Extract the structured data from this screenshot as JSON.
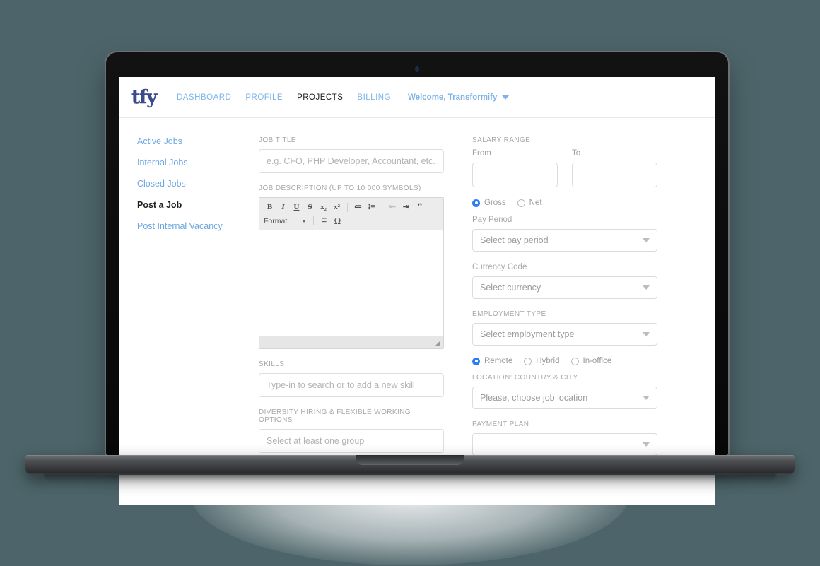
{
  "brand": {
    "logo_text": "tfy",
    "accent_blue": "#7fb4e8",
    "link_blue": "#6ba6e0",
    "radio_blue": "#2d7ff0",
    "page_background": "#4d656a"
  },
  "topnav": {
    "links": [
      {
        "label": "DASHBOARD",
        "active": false
      },
      {
        "label": "PROFILE",
        "active": false
      },
      {
        "label": "PROJECTS",
        "active": true
      },
      {
        "label": "BILLING",
        "active": false
      }
    ],
    "welcome": "Welcome, Transformify"
  },
  "sidebar": {
    "items": [
      {
        "label": "Active Jobs",
        "active": false
      },
      {
        "label": "Internal Jobs",
        "active": false
      },
      {
        "label": "Closed Jobs",
        "active": false
      },
      {
        "label": "Post a Job",
        "active": true
      },
      {
        "label": "Post Internal Vacancy",
        "active": false
      }
    ]
  },
  "form": {
    "job_title": {
      "label": "JOB TITLE",
      "placeholder": "e.g. CFO, PHP Developer, Accountant, etc.",
      "value": ""
    },
    "job_description": {
      "label": "JOB DESCRIPTION (UP TO 10 000 SYMBOLS)",
      "value": "",
      "toolbar": {
        "row1": [
          {
            "name": "bold",
            "glyph": "B",
            "dim": false
          },
          {
            "name": "italic",
            "glyph": "I",
            "dim": false
          },
          {
            "name": "underline",
            "glyph": "U",
            "dim": false
          },
          {
            "name": "strikethrough",
            "glyph": "S",
            "dim": false
          },
          {
            "name": "subscript",
            "glyph": "x₂",
            "dim": false
          },
          {
            "name": "superscript",
            "glyph": "x²",
            "dim": false
          },
          {
            "name": "numbered-list",
            "glyph": "≔",
            "dim": false
          },
          {
            "name": "bulleted-list",
            "glyph": "⁞≡",
            "dim": false
          },
          {
            "name": "decrease-indent",
            "glyph": "⇤",
            "dim": true
          },
          {
            "name": "increase-indent",
            "glyph": "⇥",
            "dim": false
          },
          {
            "name": "blockquote",
            "glyph": "”",
            "dim": false
          }
        ],
        "format_label": "Format",
        "row2": [
          {
            "name": "align",
            "glyph": "≡",
            "dim": false
          },
          {
            "name": "special-character",
            "glyph": "Ω",
            "dim": false
          }
        ]
      }
    },
    "skills": {
      "label": "SKILLS",
      "placeholder": "Type-in to search or to add a new skill",
      "value": ""
    },
    "diversity": {
      "label": "DIVERSITY HIRING & FLEXIBLE WORKING OPTIONS",
      "placeholder": "Select at least one group",
      "value": ""
    },
    "salary_range": {
      "label": "SALARY RANGE",
      "from_label": "From",
      "to_label": "To",
      "from_value": "",
      "to_value": "",
      "gross_net": [
        {
          "label": "Gross",
          "selected": true
        },
        {
          "label": "Net",
          "selected": false
        }
      ]
    },
    "pay_period": {
      "label": "Pay Period",
      "selected": "Select pay period"
    },
    "currency_code": {
      "label": "Currency Code",
      "selected": "Select currency"
    },
    "employment_type": {
      "label": "EMPLOYMENT TYPE",
      "selected": "Select employment type",
      "work_mode": [
        {
          "label": "Remote",
          "selected": true
        },
        {
          "label": "Hybrid",
          "selected": false
        },
        {
          "label": "In-office",
          "selected": false
        }
      ]
    },
    "location": {
      "label": "LOCATION: COUNTRY & CITY",
      "selected": "Please, choose job location"
    },
    "payment_plan": {
      "label": "PAYMENT PLAN",
      "selected": ""
    }
  }
}
